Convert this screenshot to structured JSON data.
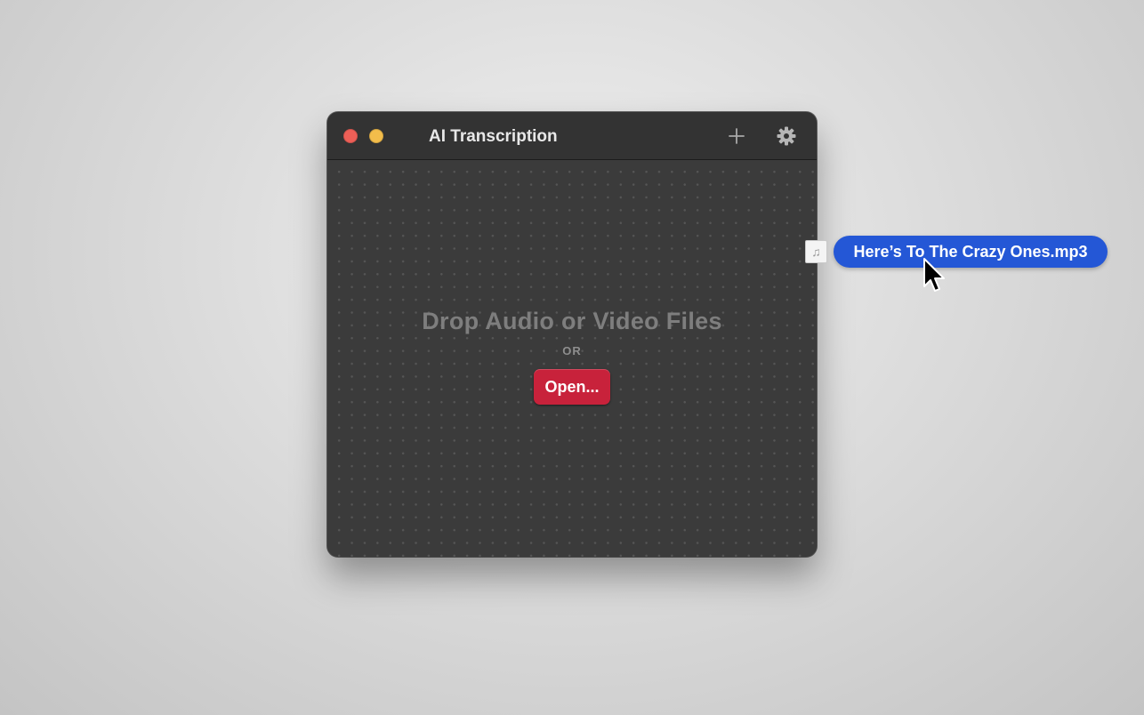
{
  "window": {
    "title": "AI Transcription"
  },
  "toolbar": {
    "add_icon": "plus-icon",
    "settings_icon": "gear-icon"
  },
  "dropzone": {
    "heading": "Drop Audio or Video Files",
    "separator": "OR",
    "open_button_label": "Open..."
  },
  "drag": {
    "file_name": "Here’s To The Crazy Ones.mp3",
    "file_icon": "music-note-icon"
  },
  "colors": {
    "accent_red": "#c8223b",
    "drag_blue": "#2457d6",
    "close": "#ed5f57",
    "minimize": "#f3bd4b"
  }
}
